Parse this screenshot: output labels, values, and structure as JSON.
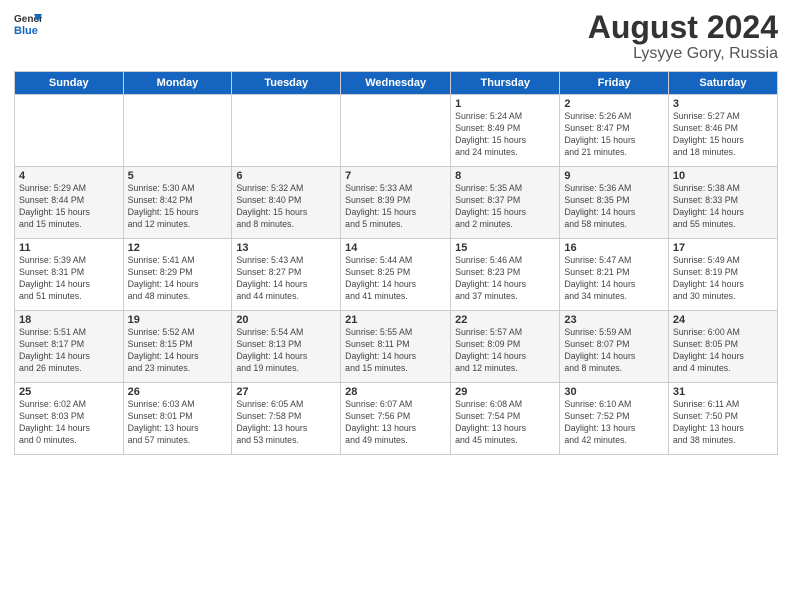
{
  "header": {
    "logo_general": "General",
    "logo_blue": "Blue",
    "month_year": "August 2024",
    "location": "Lysyye Gory, Russia"
  },
  "days_of_week": [
    "Sunday",
    "Monday",
    "Tuesday",
    "Wednesday",
    "Thursday",
    "Friday",
    "Saturday"
  ],
  "weeks": [
    [
      {
        "day": "",
        "detail": ""
      },
      {
        "day": "",
        "detail": ""
      },
      {
        "day": "",
        "detail": ""
      },
      {
        "day": "",
        "detail": ""
      },
      {
        "day": "1",
        "detail": "Sunrise: 5:24 AM\nSunset: 8:49 PM\nDaylight: 15 hours\nand 24 minutes."
      },
      {
        "day": "2",
        "detail": "Sunrise: 5:26 AM\nSunset: 8:47 PM\nDaylight: 15 hours\nand 21 minutes."
      },
      {
        "day": "3",
        "detail": "Sunrise: 5:27 AM\nSunset: 8:46 PM\nDaylight: 15 hours\nand 18 minutes."
      }
    ],
    [
      {
        "day": "4",
        "detail": "Sunrise: 5:29 AM\nSunset: 8:44 PM\nDaylight: 15 hours\nand 15 minutes."
      },
      {
        "day": "5",
        "detail": "Sunrise: 5:30 AM\nSunset: 8:42 PM\nDaylight: 15 hours\nand 12 minutes."
      },
      {
        "day": "6",
        "detail": "Sunrise: 5:32 AM\nSunset: 8:40 PM\nDaylight: 15 hours\nand 8 minutes."
      },
      {
        "day": "7",
        "detail": "Sunrise: 5:33 AM\nSunset: 8:39 PM\nDaylight: 15 hours\nand 5 minutes."
      },
      {
        "day": "8",
        "detail": "Sunrise: 5:35 AM\nSunset: 8:37 PM\nDaylight: 15 hours\nand 2 minutes."
      },
      {
        "day": "9",
        "detail": "Sunrise: 5:36 AM\nSunset: 8:35 PM\nDaylight: 14 hours\nand 58 minutes."
      },
      {
        "day": "10",
        "detail": "Sunrise: 5:38 AM\nSunset: 8:33 PM\nDaylight: 14 hours\nand 55 minutes."
      }
    ],
    [
      {
        "day": "11",
        "detail": "Sunrise: 5:39 AM\nSunset: 8:31 PM\nDaylight: 14 hours\nand 51 minutes."
      },
      {
        "day": "12",
        "detail": "Sunrise: 5:41 AM\nSunset: 8:29 PM\nDaylight: 14 hours\nand 48 minutes."
      },
      {
        "day": "13",
        "detail": "Sunrise: 5:43 AM\nSunset: 8:27 PM\nDaylight: 14 hours\nand 44 minutes."
      },
      {
        "day": "14",
        "detail": "Sunrise: 5:44 AM\nSunset: 8:25 PM\nDaylight: 14 hours\nand 41 minutes."
      },
      {
        "day": "15",
        "detail": "Sunrise: 5:46 AM\nSunset: 8:23 PM\nDaylight: 14 hours\nand 37 minutes."
      },
      {
        "day": "16",
        "detail": "Sunrise: 5:47 AM\nSunset: 8:21 PM\nDaylight: 14 hours\nand 34 minutes."
      },
      {
        "day": "17",
        "detail": "Sunrise: 5:49 AM\nSunset: 8:19 PM\nDaylight: 14 hours\nand 30 minutes."
      }
    ],
    [
      {
        "day": "18",
        "detail": "Sunrise: 5:51 AM\nSunset: 8:17 PM\nDaylight: 14 hours\nand 26 minutes."
      },
      {
        "day": "19",
        "detail": "Sunrise: 5:52 AM\nSunset: 8:15 PM\nDaylight: 14 hours\nand 23 minutes."
      },
      {
        "day": "20",
        "detail": "Sunrise: 5:54 AM\nSunset: 8:13 PM\nDaylight: 14 hours\nand 19 minutes."
      },
      {
        "day": "21",
        "detail": "Sunrise: 5:55 AM\nSunset: 8:11 PM\nDaylight: 14 hours\nand 15 minutes."
      },
      {
        "day": "22",
        "detail": "Sunrise: 5:57 AM\nSunset: 8:09 PM\nDaylight: 14 hours\nand 12 minutes."
      },
      {
        "day": "23",
        "detail": "Sunrise: 5:59 AM\nSunset: 8:07 PM\nDaylight: 14 hours\nand 8 minutes."
      },
      {
        "day": "24",
        "detail": "Sunrise: 6:00 AM\nSunset: 8:05 PM\nDaylight: 14 hours\nand 4 minutes."
      }
    ],
    [
      {
        "day": "25",
        "detail": "Sunrise: 6:02 AM\nSunset: 8:03 PM\nDaylight: 14 hours\nand 0 minutes."
      },
      {
        "day": "26",
        "detail": "Sunrise: 6:03 AM\nSunset: 8:01 PM\nDaylight: 13 hours\nand 57 minutes."
      },
      {
        "day": "27",
        "detail": "Sunrise: 6:05 AM\nSunset: 7:58 PM\nDaylight: 13 hours\nand 53 minutes."
      },
      {
        "day": "28",
        "detail": "Sunrise: 6:07 AM\nSunset: 7:56 PM\nDaylight: 13 hours\nand 49 minutes."
      },
      {
        "day": "29",
        "detail": "Sunrise: 6:08 AM\nSunset: 7:54 PM\nDaylight: 13 hours\nand 45 minutes."
      },
      {
        "day": "30",
        "detail": "Sunrise: 6:10 AM\nSunset: 7:52 PM\nDaylight: 13 hours\nand 42 minutes."
      },
      {
        "day": "31",
        "detail": "Sunrise: 6:11 AM\nSunset: 7:50 PM\nDaylight: 13 hours\nand 38 minutes."
      }
    ]
  ]
}
